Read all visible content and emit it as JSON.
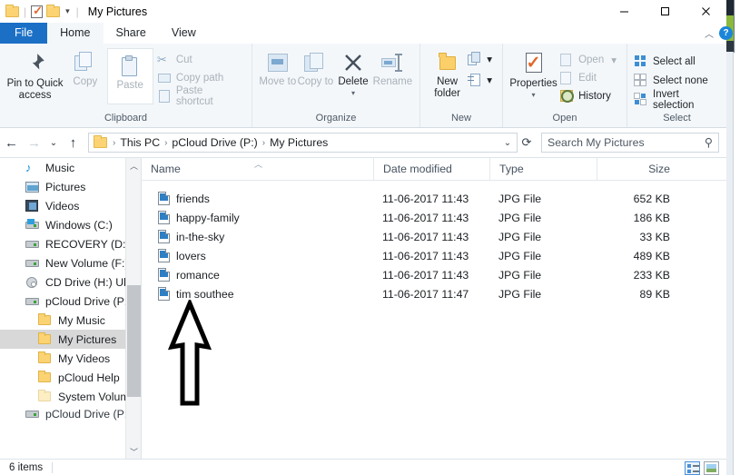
{
  "window": {
    "title": "My Pictures",
    "quick_access": [
      "folder-icon",
      "properties-check-icon",
      "folder-icon",
      "chevron-down-icon"
    ],
    "minimize_label": "Minimize",
    "maximize_label": "Maximize",
    "close_label": "Close"
  },
  "tabs": [
    {
      "label": "File",
      "kind": "file"
    },
    {
      "label": "Home",
      "kind": "active"
    },
    {
      "label": "Share",
      "kind": "normal"
    },
    {
      "label": "View",
      "kind": "normal"
    }
  ],
  "ribbon": {
    "collapse_icon": "chevron-up-icon",
    "help_icon": "help-icon",
    "help_label": "?",
    "groups": [
      {
        "title": "Clipboard",
        "big": [
          {
            "label": "Pin to Quick access",
            "icon": "pin-icon",
            "disabled": false,
            "framed": false
          },
          {
            "label": "Copy",
            "icon": "copy-icon",
            "disabled": true,
            "framed": false
          },
          {
            "label": "Paste",
            "icon": "paste-icon",
            "disabled": true,
            "framed": true
          }
        ],
        "small": [
          {
            "label": "Cut",
            "icon": "scissors-icon",
            "disabled": true
          },
          {
            "label": "Copy path",
            "icon": "copy-path-icon",
            "disabled": true
          },
          {
            "label": "Paste shortcut",
            "icon": "paste-shortcut-icon",
            "disabled": true
          }
        ]
      },
      {
        "title": "Organize",
        "big": [
          {
            "label": "Move to",
            "icon": "move-to-icon",
            "disabled": true,
            "dropdown": true
          },
          {
            "label": "Copy to",
            "icon": "copy-to-icon",
            "disabled": true,
            "dropdown": true
          },
          {
            "label": "Delete",
            "icon": "delete-icon",
            "disabled": false,
            "dropdown": true
          },
          {
            "label": "Rename",
            "icon": "rename-icon",
            "disabled": true
          }
        ],
        "small": []
      },
      {
        "title": "New",
        "big": [
          {
            "label": "New folder",
            "icon": "new-folder-icon",
            "disabled": false
          }
        ],
        "small": [
          {
            "label": "",
            "icon": "new-item-icon",
            "disabled": false
          },
          {
            "label": "",
            "icon": "easy-access-icon",
            "disabled": false
          }
        ]
      },
      {
        "title": "Open",
        "big": [
          {
            "label": "Properties",
            "icon": "properties-icon",
            "disabled": false,
            "dropdown": true
          }
        ],
        "small": [
          {
            "label": "Open",
            "icon": "open-icon",
            "disabled": true,
            "dropdown": true
          },
          {
            "label": "Edit",
            "icon": "edit-icon",
            "disabled": true
          },
          {
            "label": "History",
            "icon": "history-icon",
            "disabled": false
          }
        ]
      },
      {
        "title": "Select",
        "big": [],
        "small": [
          {
            "label": "Select all",
            "icon": "select-all-icon",
            "disabled": false
          },
          {
            "label": "Select none",
            "icon": "select-none-icon",
            "disabled": false
          },
          {
            "label": "Invert selection",
            "icon": "invert-selection-icon",
            "disabled": false
          }
        ]
      }
    ]
  },
  "address": {
    "back_icon": "arrow-left-icon",
    "forward_icon": "arrow-right-icon",
    "recent_icon": "chevron-down-icon",
    "up_icon": "arrow-up-icon",
    "folder_icon": "folder-icon",
    "breadcrumbs": [
      "This PC",
      "pCloud Drive (P:)",
      "My Pictures"
    ],
    "separator": "›",
    "dropdown_icon": "chevron-down-icon",
    "refresh_icon": "refresh-icon",
    "search_placeholder": "Search My Pictures",
    "search_value": "",
    "search_icon": "search-icon"
  },
  "sidebar": {
    "scroll_up_icon": "chevron-up-icon",
    "scroll_down_icon": "chevron-down-icon",
    "items": [
      {
        "label": "Music",
        "icon": "music-note-icon",
        "indent": false,
        "selected": false
      },
      {
        "label": "Pictures",
        "icon": "pictures-icon",
        "indent": false,
        "selected": false
      },
      {
        "label": "Videos",
        "icon": "videos-icon",
        "indent": false,
        "selected": false
      },
      {
        "label": "Windows (C:)",
        "icon": "windows-drive-icon",
        "indent": false,
        "selected": false
      },
      {
        "label": "RECOVERY (D:)",
        "icon": "drive-icon",
        "indent": false,
        "selected": false
      },
      {
        "label": "New Volume (F:)",
        "icon": "drive-icon",
        "indent": false,
        "selected": false
      },
      {
        "label": "CD Drive (H:) Ub",
        "icon": "cd-drive-icon",
        "indent": false,
        "selected": false
      },
      {
        "label": "pCloud Drive (P:",
        "icon": "drive-icon",
        "indent": false,
        "selected": false
      },
      {
        "label": "My Music",
        "icon": "folder-icon",
        "indent": true,
        "selected": false
      },
      {
        "label": "My Pictures",
        "icon": "folder-icon",
        "indent": true,
        "selected": true
      },
      {
        "label": "My Videos",
        "icon": "folder-icon",
        "indent": true,
        "selected": false
      },
      {
        "label": "pCloud Help",
        "icon": "folder-icon",
        "indent": true,
        "selected": false
      },
      {
        "label": "System Volume",
        "icon": "folder-pale-icon",
        "indent": true,
        "selected": false
      },
      {
        "label": "pCloud Drive (P:)",
        "icon": "drive-icon",
        "indent": false,
        "selected": false
      }
    ]
  },
  "filelist": {
    "columns": [
      "Name",
      "Date modified",
      "Type",
      "Size"
    ],
    "sort_icon": "sort-ascending-caret",
    "rows": [
      {
        "icon": "jpg-file-icon",
        "name": "friends",
        "date": "11-06-2017 11:43",
        "type": "JPG File",
        "size": "652 KB"
      },
      {
        "icon": "jpg-file-icon",
        "name": "happy-family",
        "date": "11-06-2017 11:43",
        "type": "JPG File",
        "size": "186 KB"
      },
      {
        "icon": "jpg-file-icon",
        "name": "in-the-sky",
        "date": "11-06-2017 11:43",
        "type": "JPG File",
        "size": "33 KB"
      },
      {
        "icon": "jpg-file-icon",
        "name": "lovers",
        "date": "11-06-2017 11:43",
        "type": "JPG File",
        "size": "489 KB"
      },
      {
        "icon": "jpg-file-icon",
        "name": "romance",
        "date": "11-06-2017 11:43",
        "type": "JPG File",
        "size": "233 KB"
      },
      {
        "icon": "jpg-file-icon",
        "name": "tim southee",
        "date": "11-06-2017 11:47",
        "type": "JPG File",
        "size": "89 KB"
      }
    ]
  },
  "annotation": {
    "shape": "up-arrow-outline",
    "color": "#000000"
  },
  "statusbar": {
    "item_count": "6 items",
    "details_view_icon": "details-view-icon",
    "thumbnail_view_icon": "large-icons-view-icon"
  },
  "colors": {
    "file_tab": "#1b70c6",
    "ribbon_bg": "#f4f7fa",
    "selection": "#d8d8d8",
    "accent": "#1b86d8"
  }
}
